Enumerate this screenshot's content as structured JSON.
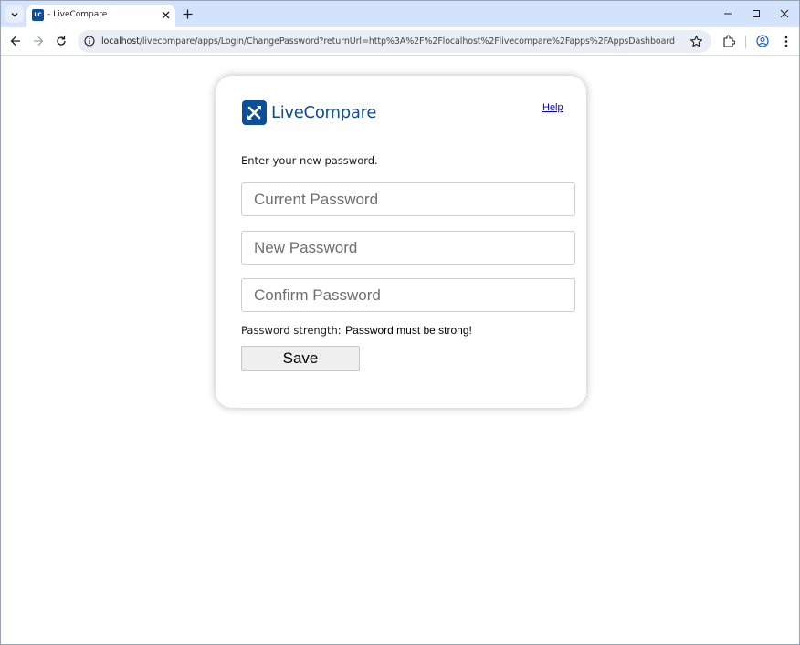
{
  "browser": {
    "tab": {
      "favicon_text": "LC",
      "title": " - LiveCompare"
    },
    "url": {
      "host": "localhost",
      "path": "/livecompare/apps/Login/ChangePassword?returnUrl=http%3A%2F%2Flocalhost%2Flivecompare%2Fapps%2FAppsDashboard"
    }
  },
  "page": {
    "logo_text": "LiveCompare",
    "help_link": "Help",
    "instruction": "Enter your new password.",
    "fields": {
      "current_password_placeholder": "Current Password",
      "new_password_placeholder": "New Password",
      "confirm_password_placeholder": "Confirm Password"
    },
    "strength": {
      "label": "Password strength:",
      "value": "Password must be strong!"
    },
    "save_label": "Save"
  },
  "colors": {
    "brand": "#0b4f9c",
    "tabstrip": "#d3e3fd",
    "omnibox": "#e9eef6"
  }
}
